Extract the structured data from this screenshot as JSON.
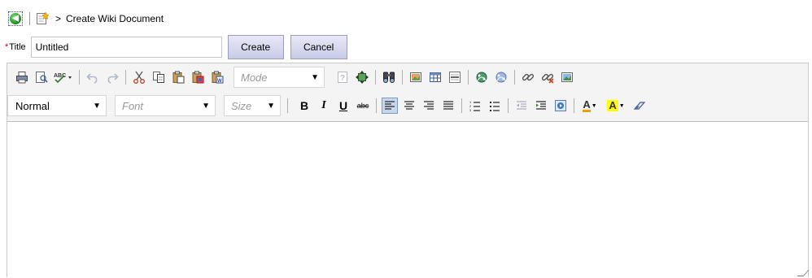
{
  "breadcrumb": {
    "separator": ">",
    "title": "Create Wiki Document"
  },
  "form": {
    "required_mark": "*",
    "title_label": "Title",
    "title_value": "Untitled",
    "create_label": "Create",
    "cancel_label": "Cancel"
  },
  "toolbar": {
    "mode_label": "Mode",
    "format_label": "Normal",
    "font_label": "Font",
    "size_label": "Size",
    "bold_label": "B",
    "italic_label": "I",
    "underline_label": "U",
    "strike_label": "abc",
    "text_color_label": "A",
    "bg_color_label": "A",
    "active_alignment": "left"
  },
  "colors": {
    "button_gradient_top": "#e8e8f8",
    "button_gradient_bottom": "#c9cbe6",
    "required": "#dd0000",
    "text_color_swatch": "#f0a000",
    "bg_color_swatch": "#ffff00"
  },
  "icons": {
    "row1": [
      "print-icon",
      "preview-icon",
      "spellcheck-icon",
      "undo-icon",
      "redo-icon",
      "cut-icon",
      "copy-icon",
      "paste-icon",
      "paste-text-icon",
      "paste-word-icon",
      "help-icon",
      "maximize-icon",
      "find-icon",
      "image-icon",
      "table-icon",
      "horizontal-rule-icon",
      "anchor-icon",
      "remove-anchor-icon",
      "link-icon",
      "unlink-icon",
      "insert-image-icon"
    ],
    "row2": [
      "bold-icon",
      "italic-icon",
      "underline-icon",
      "strikethrough-icon",
      "align-left-icon",
      "align-center-icon",
      "align-right-icon",
      "justify-icon",
      "numbered-list-icon",
      "bulleted-list-icon",
      "outdent-icon",
      "indent-icon",
      "blockquote-icon",
      "text-color-icon",
      "bg-color-icon",
      "eraser-icon"
    ]
  }
}
